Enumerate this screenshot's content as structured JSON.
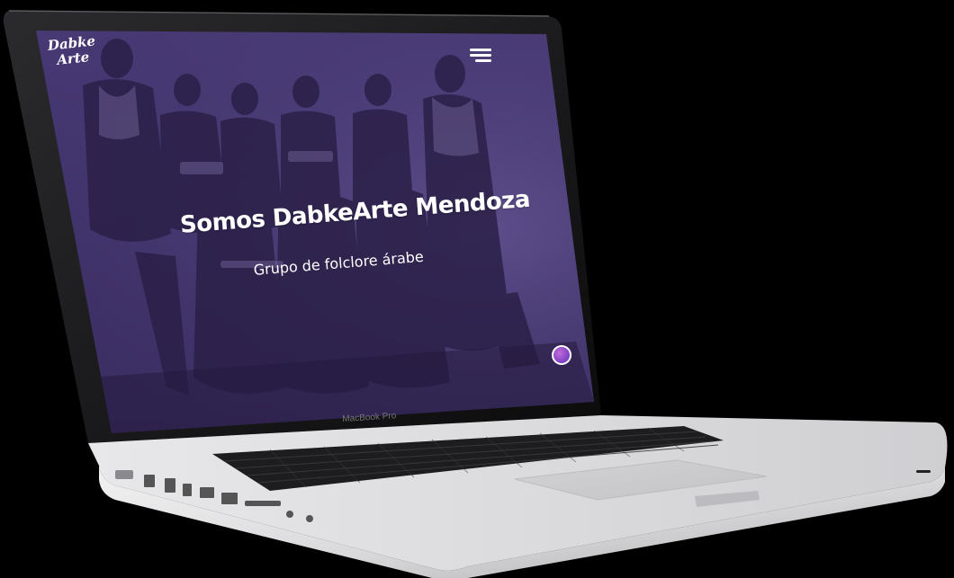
{
  "device": {
    "model_label": "MacBook Pro"
  },
  "site": {
    "logo_line1": "Dabke",
    "logo_line2": "Arte",
    "menu_icon": "hamburger-icon",
    "hero_title": "Somos DabkeArte Mendoza",
    "hero_subtitle": "Grupo de folclore árabe",
    "chat_icon": "chat-bubble-icon",
    "overlay_color": "#4a3b78"
  }
}
